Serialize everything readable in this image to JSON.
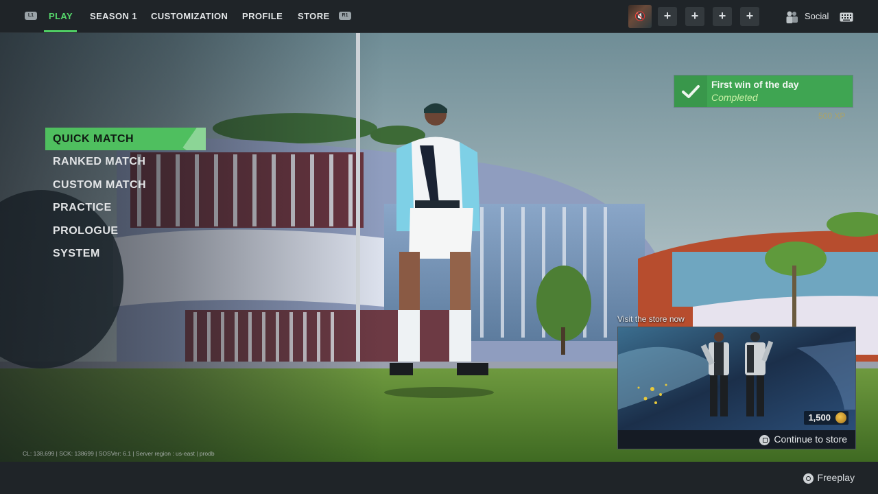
{
  "top_nav": {
    "left_bumper": "L1",
    "right_bumper": "R1",
    "tabs": [
      {
        "label": "PLAY",
        "active": true
      },
      {
        "label": "SEASON 1",
        "active": false
      },
      {
        "label": "CUSTOMIZATION",
        "active": false
      },
      {
        "label": "PROFILE",
        "active": false
      },
      {
        "label": "STORE",
        "active": false
      }
    ],
    "party_slots": [
      "+",
      "+",
      "+",
      "+"
    ],
    "social_label": "Social"
  },
  "menu": {
    "items": [
      {
        "label": "QUICK MATCH",
        "selected": true
      },
      {
        "label": "RANKED MATCH",
        "selected": false
      },
      {
        "label": "CUSTOM MATCH",
        "selected": false
      },
      {
        "label": "PRACTICE",
        "selected": false
      },
      {
        "label": "PROLOGUE",
        "selected": false
      },
      {
        "label": "SYSTEM",
        "selected": false
      }
    ]
  },
  "quest": {
    "title": "First win of the day",
    "status": "Completed",
    "reward": "500 XP"
  },
  "store_promo": {
    "label": "Visit the store now",
    "price": "1,500",
    "cta": "Continue to store"
  },
  "footer": {
    "build_info": "CL: 138,699 | SCK: 138699 | SOSVer: 6.1 | Server region : us-east | prodb",
    "action_label": "Freeplay"
  },
  "colors": {
    "accent": "#4fbf5f",
    "bar_bg": "#1f2428",
    "quest_bg": "#3fa552"
  }
}
